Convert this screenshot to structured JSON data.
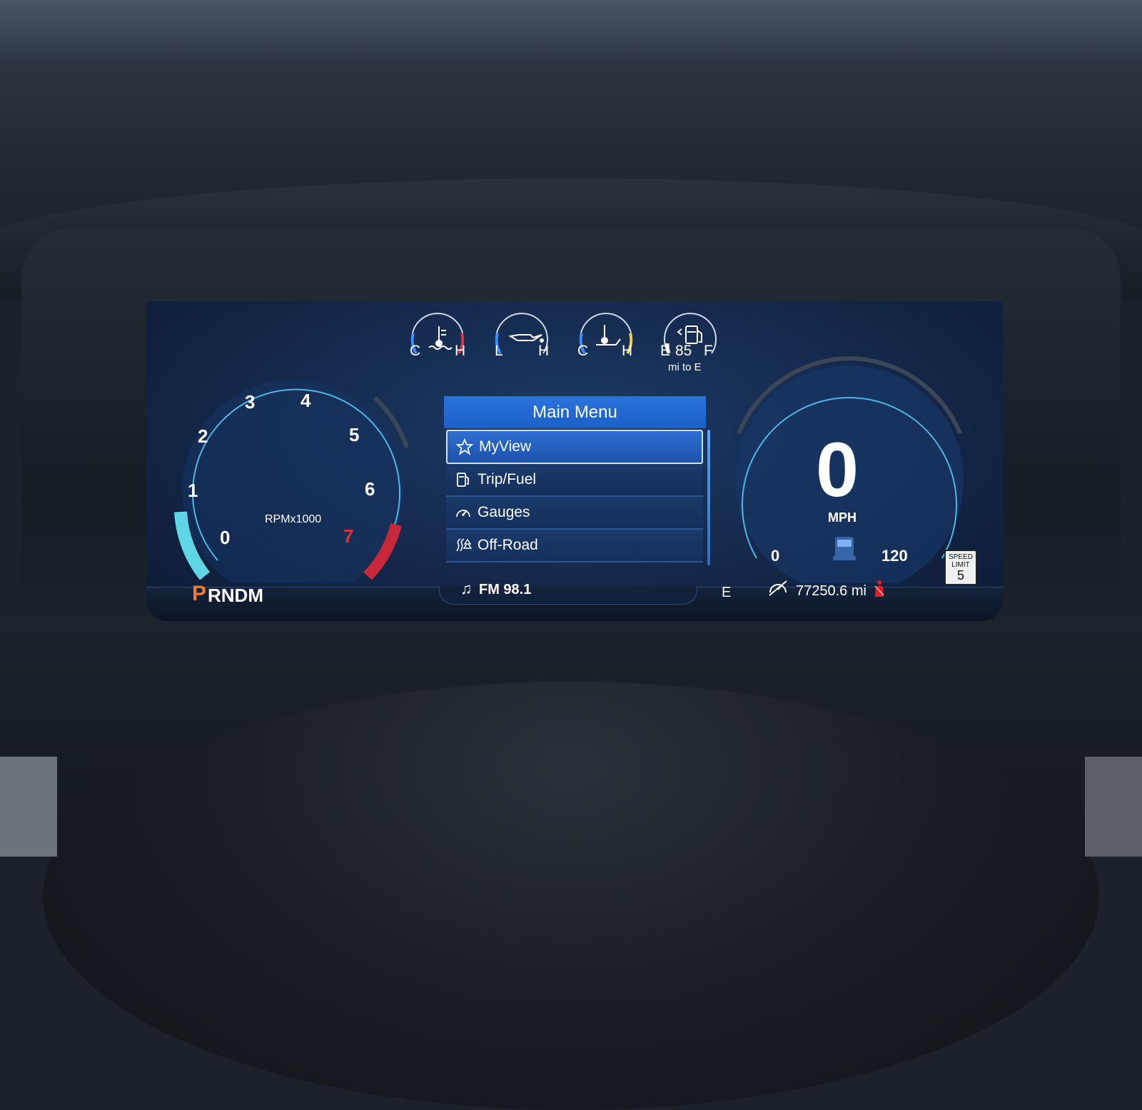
{
  "top_gauges": {
    "coolant": {
      "icon": "coolant-temp-icon",
      "low": "C",
      "high": "H"
    },
    "oil": {
      "icon": "oil-pressure-icon",
      "low": "L",
      "high": "H"
    },
    "trans": {
      "icon": "transmission-temp-icon",
      "low": "C",
      "high": "H"
    },
    "fuel": {
      "icon": "fuel-pump-icon",
      "low": "E",
      "high": "F",
      "range_value": "85",
      "range_label": "mi to E"
    }
  },
  "tachometer": {
    "ticks": [
      "0",
      "1",
      "2",
      "3",
      "4",
      "5",
      "6",
      "7"
    ],
    "unit_label": "RPMx1000"
  },
  "menu": {
    "title": "Main Menu",
    "items": [
      {
        "label": "MyView",
        "icon": "star-icon",
        "selected": true
      },
      {
        "label": "Trip/Fuel",
        "icon": "fuel-icon",
        "selected": false
      },
      {
        "label": "Gauges",
        "icon": "gauge-icon",
        "selected": false
      },
      {
        "label": "Off-Road",
        "icon": "off-road-icon",
        "selected": false
      }
    ]
  },
  "speedometer": {
    "speed": "0",
    "unit": "MPH",
    "min": "0",
    "max": "120",
    "speed_limit_label_1": "SPEED",
    "speed_limit_label_2": "LIMIT",
    "speed_limit_value": "5"
  },
  "status_bar": {
    "gear_selected": "P",
    "gear_rest": "RNDM",
    "media": "FM 98.1",
    "compass": "E",
    "odometer": "77250.6 mi"
  },
  "colors": {
    "accent": "#2b73de",
    "gear_selected": "#f47a2a",
    "redline": "#c8283a",
    "cyan": "#5fd6e6",
    "seatbelt": "#e0202a"
  }
}
